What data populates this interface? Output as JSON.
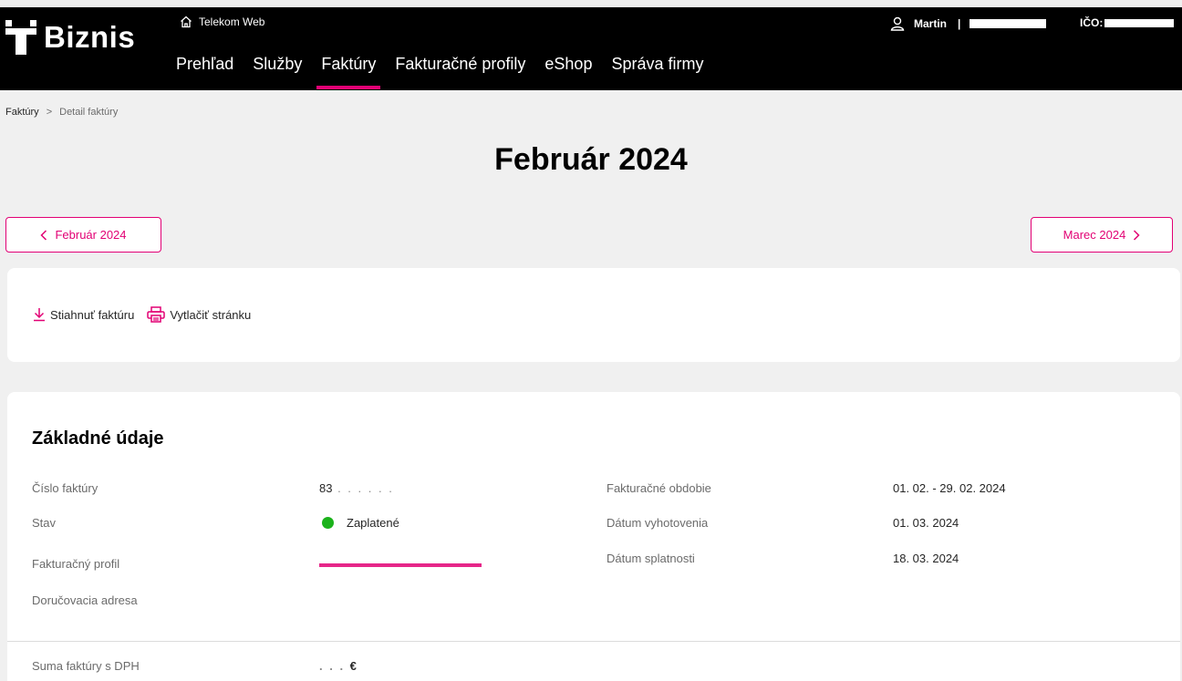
{
  "header": {
    "brand": "Biznis",
    "telekom_link": "Telekom Web",
    "nav": [
      {
        "label": "Prehľad"
      },
      {
        "label": "Služby"
      },
      {
        "label": "Faktúry"
      },
      {
        "label": "Fakturačné profily"
      },
      {
        "label": "eShop"
      },
      {
        "label": "Správa firmy"
      }
    ],
    "active_nav": "Faktúry",
    "user_name": "Martin",
    "separator": "|",
    "ico_label": "IČO:"
  },
  "breadcrumb": {
    "parent": "Faktúry",
    "separator": ">",
    "current": "Detail faktúry"
  },
  "page_title": "Február 2024",
  "pager": {
    "prev_label": "Február 2024",
    "next_label": "Marec 2024"
  },
  "actions": {
    "download_label": "Stiahnuť faktúru",
    "print_label": "Vytlačiť stránku"
  },
  "basic_info": {
    "title": "Základné údaje",
    "invoice_number_label": "Číslo faktúry",
    "invoice_number_value": "83",
    "status_label": "Stav",
    "status_value": "Zaplatené",
    "billing_profile_label": "Fakturačný profil",
    "delivery_address_label": "Doručovacia adresa",
    "billing_period_label": "Fakturačné obdobie",
    "billing_period_value": "01. 02. - 29. 02. 2024",
    "issue_date_label": "Dátum vyhotovenia",
    "issue_date_value": "01. 03. 2024",
    "due_date_label": "Dátum splatnosti",
    "due_date_value": "18. 03. 2024",
    "total_label": "Suma faktúry s DPH",
    "total_currency": "€"
  },
  "colors": {
    "accent": "#e20074",
    "status_paid": "#1bb21b",
    "header_bg": "#000000"
  }
}
